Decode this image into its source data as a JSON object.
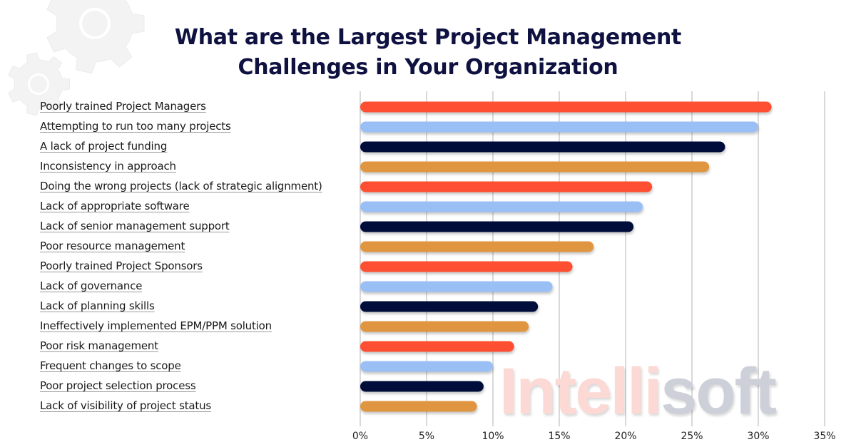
{
  "chart_data": {
    "type": "bar",
    "orientation": "horizontal",
    "title": "What are the Largest Project Management Challenges in Your Organization",
    "title_lines": [
      "What are the Largest Project Management",
      "Challenges in Your Organization"
    ],
    "xlabel": "",
    "ylabel": "",
    "xlim": [
      0,
      35
    ],
    "x_ticks": [
      0,
      5,
      10,
      15,
      20,
      25,
      30,
      35
    ],
    "x_tick_labels": [
      "0%",
      "5%",
      "10%",
      "15%",
      "20%",
      "25%",
      "30%",
      "35%"
    ],
    "grid": "vertical",
    "legend": "none",
    "categories": [
      "Poorly trained Project Managers",
      "Attempting to run too many projects",
      "A lack of project funding",
      "Inconsistency in approach",
      "Doing the wrong projects (lack of strategic alignment)",
      "Lack of appropriate software",
      "Lack of senior management support",
      "Poor resource management",
      "Poorly trained Project Sponsors",
      "Lack of governance",
      "Lack of planning skills",
      "Ineffectively implemented EPM/PPM solution",
      "Poor risk management",
      "Frequent changes to scope",
      "Poor project selection process",
      "Lack of visibility of project status"
    ],
    "values": [
      31,
      30,
      27.5,
      26.3,
      22,
      21.3,
      20.6,
      17.6,
      16,
      14.5,
      13.4,
      12.7,
      11.6,
      10,
      9.3,
      8.8
    ],
    "unit": "%",
    "bar_color_cycle": [
      "#ff4f33",
      "#99bff5",
      "#02093b",
      "#e0963f"
    ]
  },
  "watermark": {
    "part1": "Intelli",
    "part2": "soft"
  },
  "decorations": [
    "gear-icon-large",
    "gear-icon-small"
  ]
}
